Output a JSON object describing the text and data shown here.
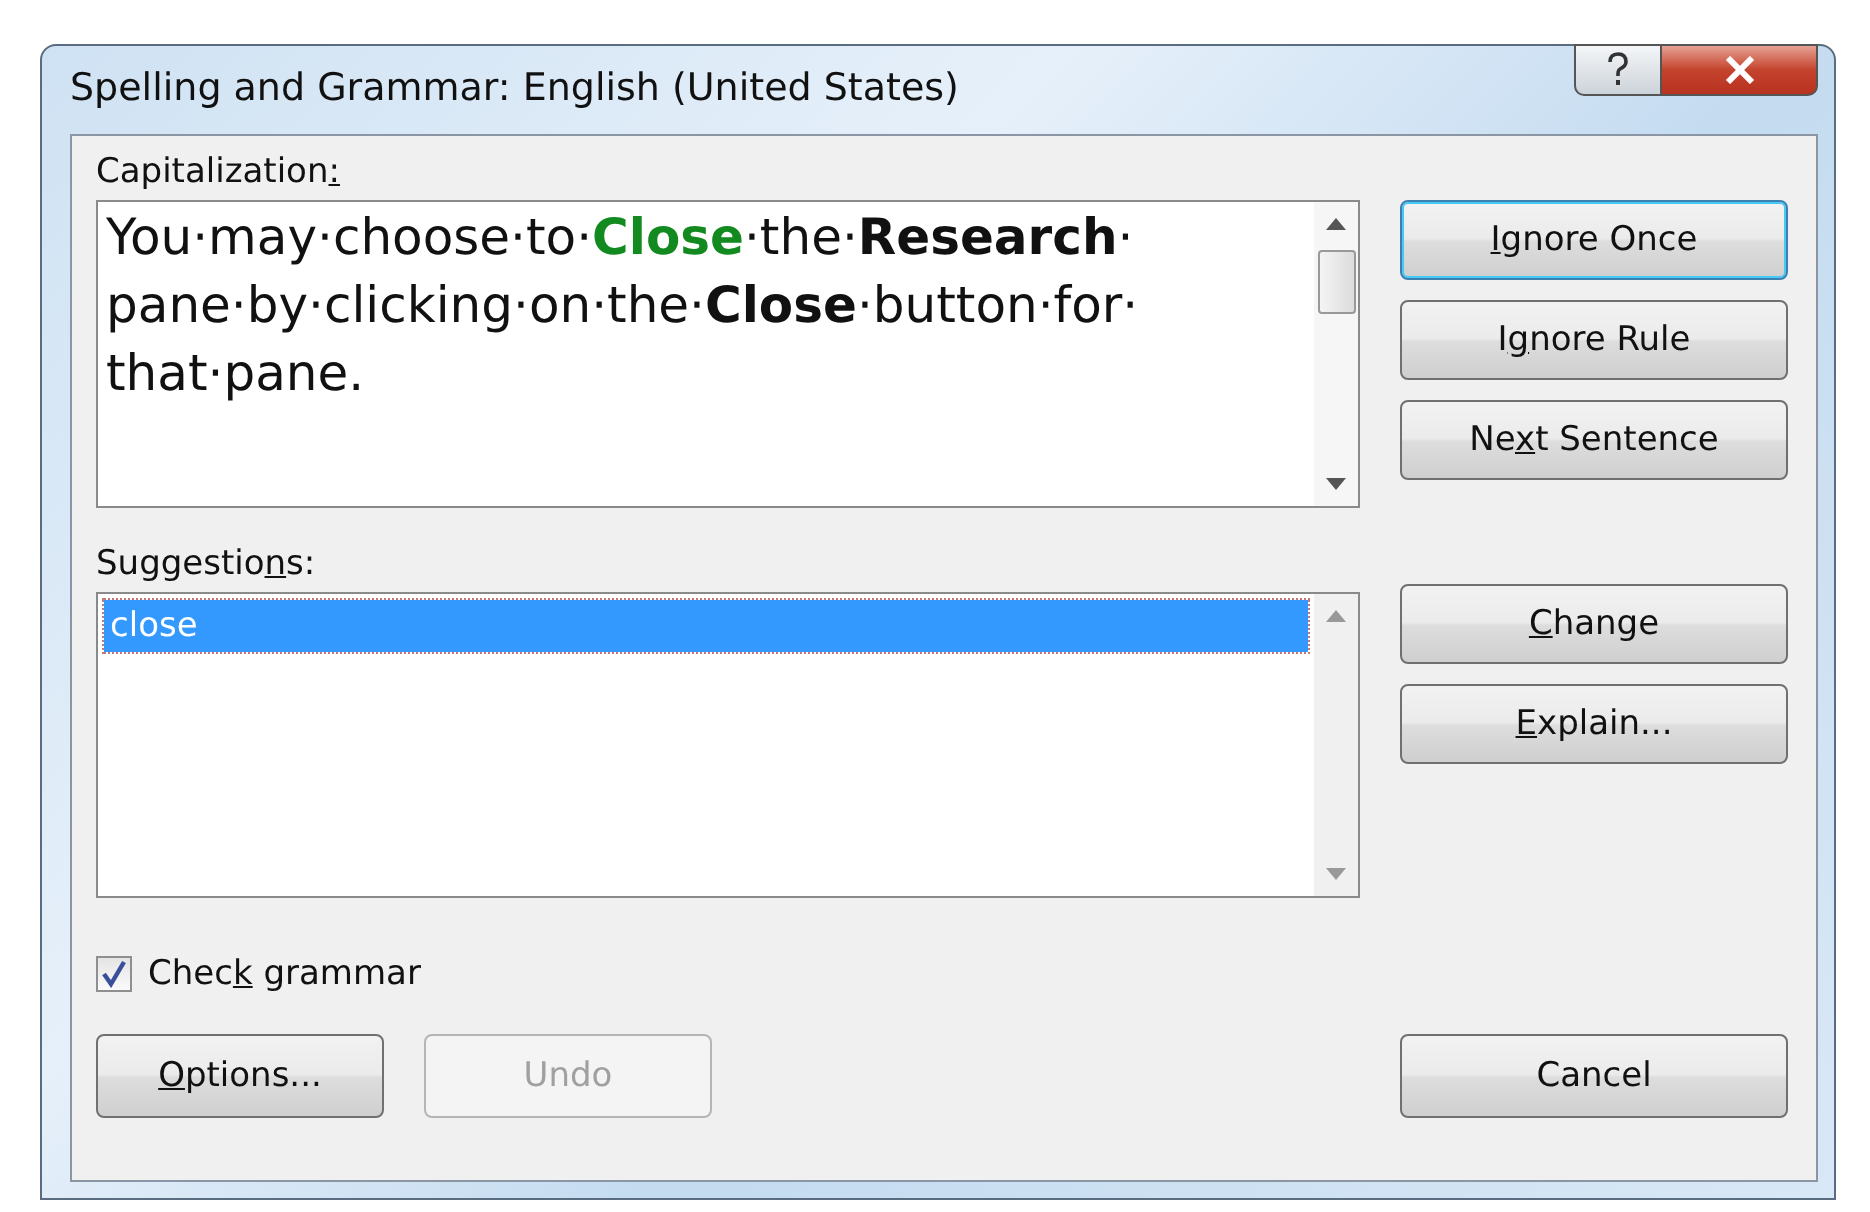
{
  "window": {
    "title": "Spelling and Grammar: English (United States)"
  },
  "issue": {
    "label": {
      "before": "Capitalization",
      "key": ":"
    },
    "sentence": [
      {
        "text": "You·may·choose·to·",
        "kind": "plain"
      },
      {
        "text": "Close",
        "kind": "error"
      },
      {
        "text": "·the·",
        "kind": "plain"
      },
      {
        "text": "Research",
        "kind": "bold"
      },
      {
        "text": "· pane·by·clicking·on·the·",
        "kind": "plain"
      },
      {
        "text": "Close",
        "kind": "bold"
      },
      {
        "text": "·button·for· that·pane.",
        "kind": "plain"
      }
    ]
  },
  "suggestions": {
    "label": {
      "before": "Suggestio",
      "key": "n",
      "after": "s:"
    },
    "items": [
      {
        "text": "close",
        "selected": true
      }
    ]
  },
  "side_buttons_top": [
    {
      "label": {
        "key": "I",
        "after": "gnore Once"
      },
      "focused": true
    },
    {
      "label": {
        "before": "I",
        "key": "g",
        "after": "nore Rule"
      },
      "focused": false
    },
    {
      "label": {
        "before": "Ne",
        "key": "x",
        "after": "t Sentence"
      },
      "focused": false
    }
  ],
  "side_buttons_bottom": [
    {
      "label": {
        "key": "C",
        "after": "hange"
      },
      "focused": false
    },
    {
      "label": {
        "key": "E",
        "after": "xplain..."
      },
      "focused": false
    }
  ],
  "check_grammar": {
    "label": {
      "before": "Chec",
      "key": "k",
      "after": " grammar"
    },
    "checked": true
  },
  "footer_buttons_left": [
    {
      "label": {
        "key": "O",
        "after": "ptions..."
      },
      "disabled": false
    },
    {
      "label": {
        "before": "Undo"
      },
      "disabled": true
    }
  ],
  "footer_buttons_right": [
    {
      "label": {
        "before": "Cancel"
      },
      "disabled": false
    }
  ]
}
